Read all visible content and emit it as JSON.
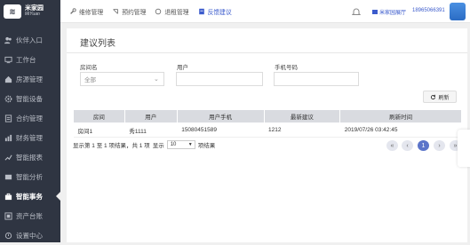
{
  "app": {
    "logo_mark": "≋",
    "logo_line1": "米家园",
    "logo_line2": "MiYuan"
  },
  "sidebar": {
    "items": [
      {
        "label": "伙伴入口",
        "icon": "people-icon"
      },
      {
        "label": "工作台",
        "icon": "monitor-icon"
      },
      {
        "label": "房源管理",
        "icon": "home-icon"
      },
      {
        "label": "智能设备",
        "icon": "gear-icon"
      },
      {
        "label": "合约管理",
        "icon": "contract-icon"
      },
      {
        "label": "财务管理",
        "icon": "finance-icon"
      },
      {
        "label": "智能报表",
        "icon": "report-icon"
      },
      {
        "label": "智能分析",
        "icon": "analysis-icon"
      },
      {
        "label": "智能事务",
        "icon": "briefcase-icon",
        "active": true
      },
      {
        "label": "资产台账",
        "icon": "asset-icon"
      },
      {
        "label": "设置中心",
        "icon": "settings-icon"
      }
    ]
  },
  "topbar": {
    "nav": [
      {
        "label": "维修管理",
        "icon": "wrench-icon"
      },
      {
        "label": "预约管理",
        "icon": "booking-icon"
      },
      {
        "label": "退租管理",
        "icon": "checkout-icon"
      },
      {
        "label": "反馈建议",
        "icon": "feedback-icon",
        "active": true
      }
    ],
    "user_name": "米家园展厅",
    "phone": "18965066391"
  },
  "panel": {
    "title": "建议列表",
    "filters": {
      "room_label": "房间名",
      "room_value": "全部",
      "user_label": "用户",
      "phone_label": "手机号码"
    },
    "refresh_label": "刷新",
    "table": {
      "columns": [
        "房间",
        "用户",
        "用户手机",
        "最新建议",
        "刷新时间"
      ],
      "rows": [
        [
          "房间1",
          "秀1111",
          "15080451589",
          "1212",
          "2019/07/26 03:42:45"
        ]
      ]
    },
    "pagination": {
      "info_prefix": "显示第 1 至 1 项结果，共 1 项",
      "show_label": "显示",
      "page_size": "10",
      "suffix": "项结果",
      "first": "«",
      "prev": "‹",
      "current": "1",
      "next": "›",
      "last": "»"
    }
  },
  "colors": {
    "sidebar_bg": "#2f3542",
    "accent": "#3b5bcc",
    "pager_active": "#5b74c9"
  }
}
